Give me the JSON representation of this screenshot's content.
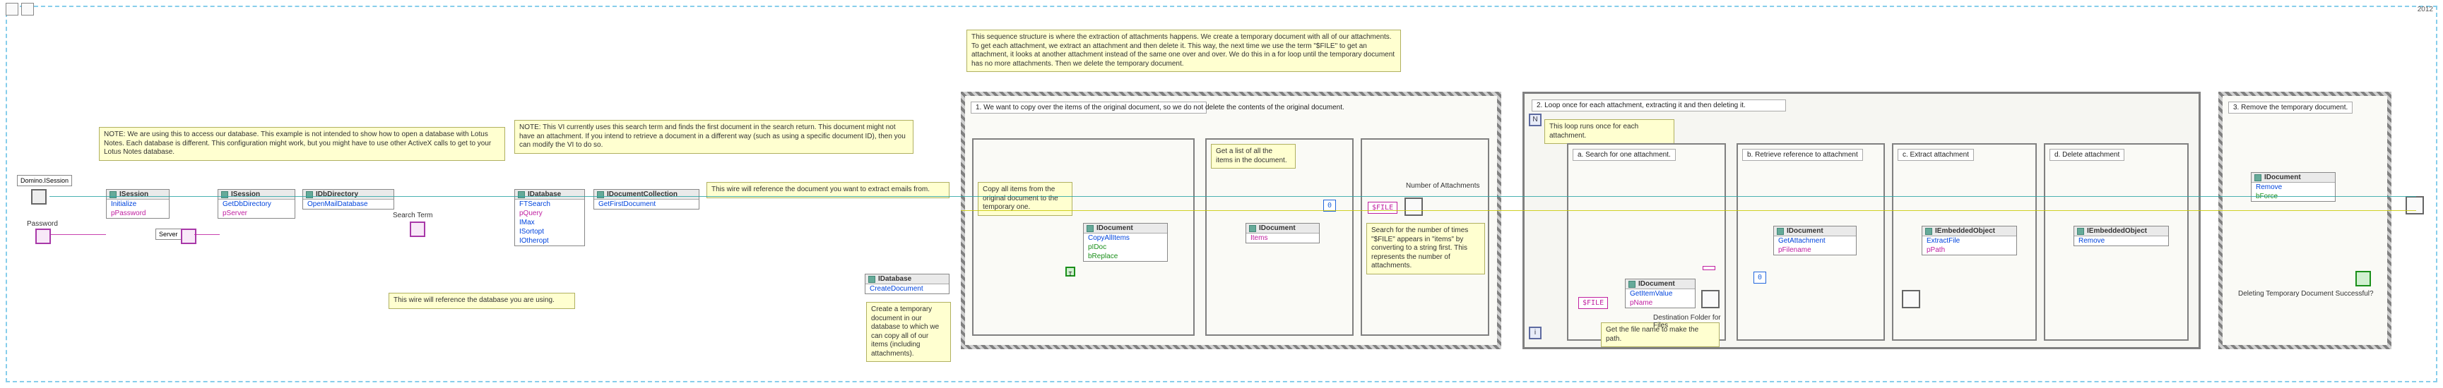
{
  "frame": {
    "year": "2012"
  },
  "notes": {
    "open_db": "NOTE: We are using this to access our database. This example is not intended to show how to open a database with Lotus Notes. Each database is different. This configuration might work, but you might have to use other ActiveX calls to get to your Lotus Notes database.",
    "search": "NOTE: This VI currently uses this search term and finds the first document in the search return. This document might not have an attachment.\nIf you intend to retrieve a document in a different way  (such as using a specific document ID), then you can modify the VI to do so.",
    "wire_db": "This wire will reference the database you are using.",
    "wire_doc": "This wire will reference the document you want to extract emails from.",
    "temp_doc": "Create a temporary document in our database to which we can copy all of our items (including attachments).",
    "top_seq": "This sequence structure is where the extraction of attachments happens.\nWe create a temporary document with all of our attachments. To get each attachment, we extract an attachment and then delete it. This way, the next time we use the term \"$FILE\" to get an attachment, it looks at another attachment instead of the same one over and over. We do this in a for loop until the temporary document has no more attachments. Then we delete the temporary document."
  },
  "seq_titles": {
    "copy": "1. We want to copy over the items of the original document, so we do not delete the contents of the original document.",
    "count": "2. Loop once for each attachment, extracting it and then deleting it.",
    "loop_inner": "This loop runs once for each attachment.",
    "get_items": "Get a list of all the items in the document.",
    "copy_items": "Copy all items from the original document to the temporary one.",
    "num_attach": "Number of Attachments",
    "count_note": "Search for the number of times \"$FILE\" appears in \"items\" by converting to a string first. This represents the number of attachments.",
    "a": "a. Search for one attachment.",
    "b": "b. Retrieve reference to attachment",
    "c": "c. Extract attachment",
    "d": "d. Delete attachment",
    "remove": "3. Remove the temporary document.",
    "del_q": "Deleting Temporary Document Successful?",
    "filename_note": "Get the file name to make the path.",
    "dest": "Destination Folder for Files"
  },
  "nodes": {
    "domino": "Domino.ISession",
    "isession": "ISession",
    "initialize": "Initialize",
    "ppassword": "pPassword",
    "server_label": "Server",
    "pserver": "pServer",
    "getdbdir": "GetDbDirectory",
    "idbdirectory": "IDbDirectory",
    "openmail": "OpenMailDatabase",
    "searchterm": "Search Term",
    "idatabase": "IDatabase",
    "ftsearch": "FTSearch",
    "pquery": "pQuery",
    "imax": "IMax",
    "isortopt": "ISortopt",
    "iotheropt": "IOtheropt",
    "idoccoll": "IDocumentCollection",
    "getfirst": "GetFirstDocument",
    "createdoc": "CreateDocument",
    "idocument": "IDocument",
    "copyall": "CopyAllItems",
    "pidoc": "pIDoc",
    "breplace": "bReplace",
    "items": "Items",
    "sfile": "$FILE",
    "getitemval": "GetItemValue",
    "pname": "pName",
    "getattach": "GetAttachment",
    "pfilename": "pFilename",
    "iembed": "IEmbeddedObject",
    "extractfile": "ExtractFile",
    "ppath": "pPath",
    "remove": "Remove",
    "bforce": "bForce",
    "zero": "0",
    "password_label": "Password"
  }
}
